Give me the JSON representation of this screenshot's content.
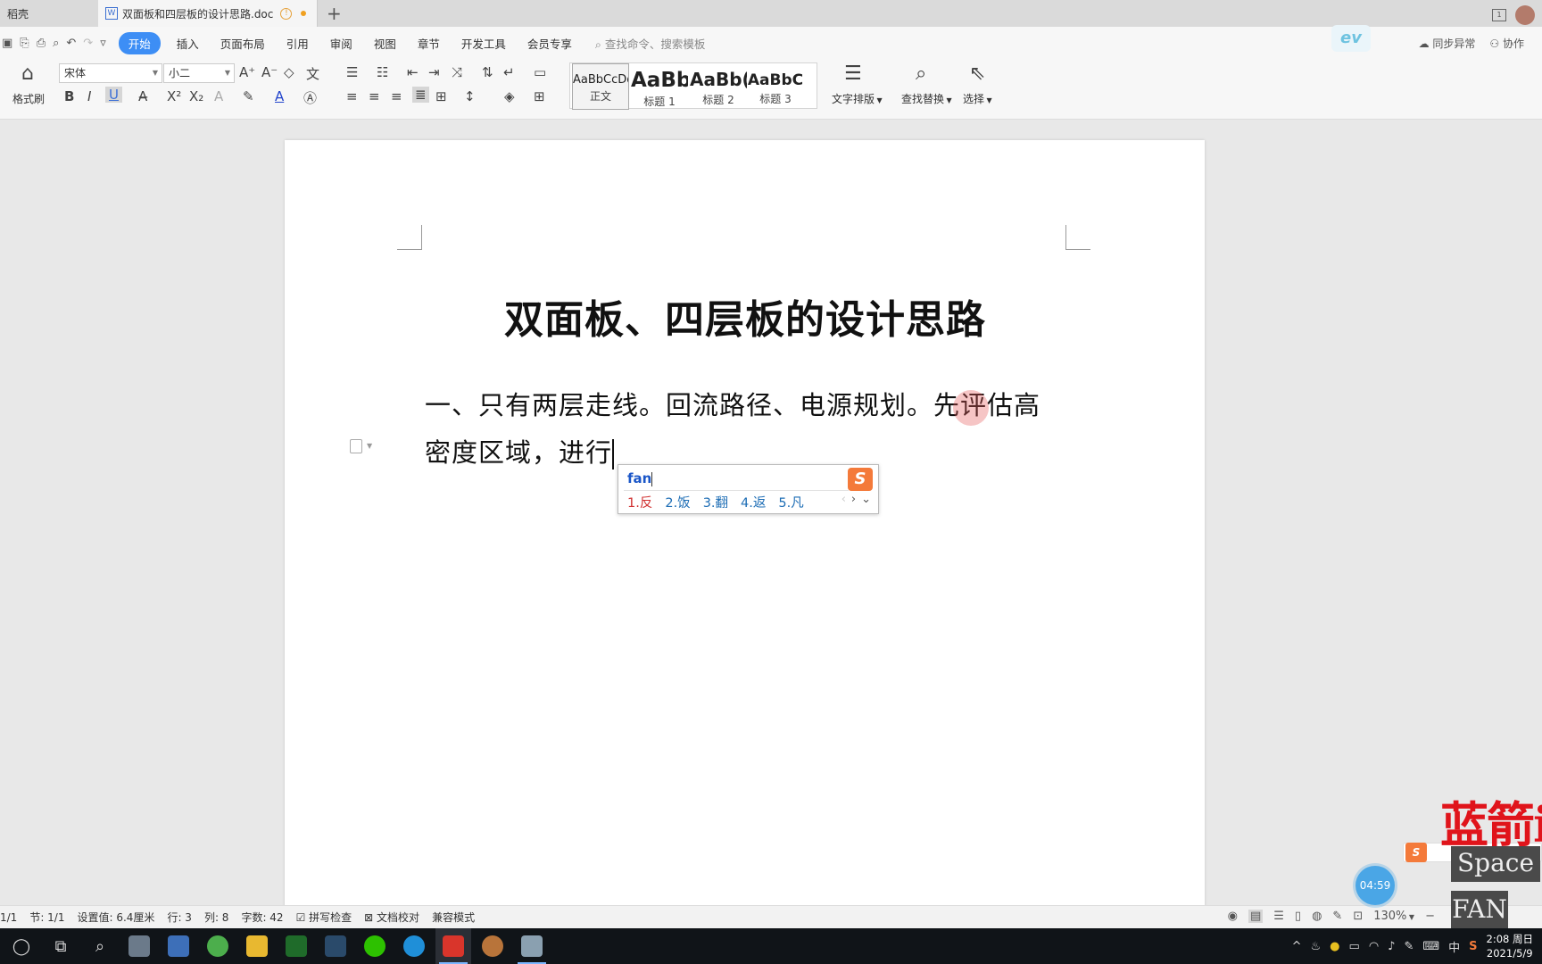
{
  "tabs": [
    {
      "label": "稻壳"
    },
    {
      "label": "双面板和四层板的设计思路.doc"
    }
  ],
  "menu": {
    "items": [
      "开始",
      "插入",
      "页面布局",
      "引用",
      "审阅",
      "视图",
      "章节",
      "开发工具",
      "会员专享"
    ],
    "search_placeholder": "查找命令、搜索模板",
    "right": [
      "同步异常",
      "协作"
    ]
  },
  "ribbon": {
    "format_painter": "格式刷",
    "font_name": "宋体",
    "font_size": "小二",
    "styles": [
      {
        "preview": "AaBbCcDd",
        "label": "正文"
      },
      {
        "preview": "AaBb",
        "label": "标题 1"
      },
      {
        "preview": "AaBb(",
        "label": "标题 2"
      },
      {
        "preview": "AaBbC",
        "label": "标题 3"
      }
    ],
    "text_layout": "文字排版",
    "find_replace": "查找替换",
    "select": "选择"
  },
  "document": {
    "title": "双面板、四层板的设计思路",
    "line1": "一、只有两层走线。回流路径、电源规划。先评估高",
    "line2": "密度区域，进行"
  },
  "ime": {
    "input": "fan",
    "candidates": [
      "1.反",
      "2.饭",
      "3.翻",
      "4.返",
      "5.凡"
    ]
  },
  "statusbar": {
    "page": "1/1",
    "section": "节: 1/1",
    "setting": "设置值: 6.4厘米",
    "row": "行: 3",
    "col": "列: 8",
    "word_count": "字数: 42",
    "spell_check": "拼写检查",
    "doc_proof": "文档校对",
    "compat": "兼容模式",
    "zoom": "130%"
  },
  "overlay": {
    "timer": "04:59",
    "red_text": "蓝箭i",
    "key_space": "Space",
    "key_fan": "FAN"
  },
  "taskbar": {
    "time": "2:08 周日",
    "date": "2021/5/9",
    "ime_lang": "中"
  },
  "colors": {
    "accent": "#3d8ef5",
    "sogou_orange": "#f47a3a",
    "candidate_first": "#d03030",
    "candidate": "#1d6db5"
  }
}
